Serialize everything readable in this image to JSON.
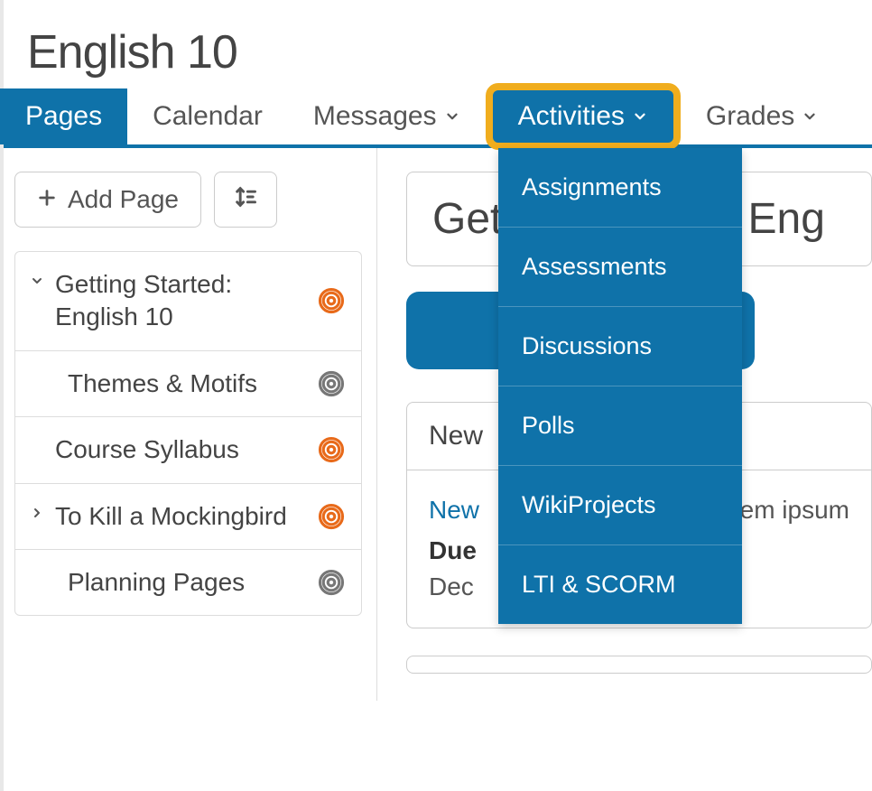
{
  "page": {
    "title": "English 10"
  },
  "nav": {
    "tabs": [
      {
        "label": "Pages",
        "hasDropdown": false,
        "active": true
      },
      {
        "label": "Calendar",
        "hasDropdown": false,
        "active": false
      },
      {
        "label": "Messages",
        "hasDropdown": true,
        "active": false
      },
      {
        "label": "Activities",
        "hasDropdown": true,
        "active": false,
        "highlighted": true
      },
      {
        "label": "Grades",
        "hasDropdown": true,
        "active": false
      }
    ]
  },
  "sidebar": {
    "addPageLabel": "Add Page",
    "items": [
      {
        "label": "Getting Started: English 10",
        "expanded": true,
        "rssColor": "orange",
        "child": false,
        "hasCaret": true
      },
      {
        "label": "Themes & Motifs",
        "expanded": false,
        "rssColor": "gray",
        "child": true,
        "hasCaret": false
      },
      {
        "label": "Course Syllabus",
        "expanded": false,
        "rssColor": "orange",
        "child": false,
        "hasCaret": false
      },
      {
        "label": "To Kill a Mockingbird",
        "expanded": false,
        "rssColor": "orange",
        "child": false,
        "hasCaret": true
      },
      {
        "label": "Planning Pages",
        "expanded": false,
        "rssColor": "gray",
        "child": true,
        "hasCaret": false
      }
    ]
  },
  "main": {
    "heading": "Getting Started: Eng",
    "card": {
      "header": "New",
      "linkText": "New",
      "descFragment": "rem ipsum",
      "dueLabel": "Due",
      "dueValue": "Dec"
    }
  },
  "dropdown": {
    "items": [
      "Assignments",
      "Assessments",
      "Discussions",
      "Polls",
      "WikiProjects",
      "LTI & SCORM"
    ]
  }
}
